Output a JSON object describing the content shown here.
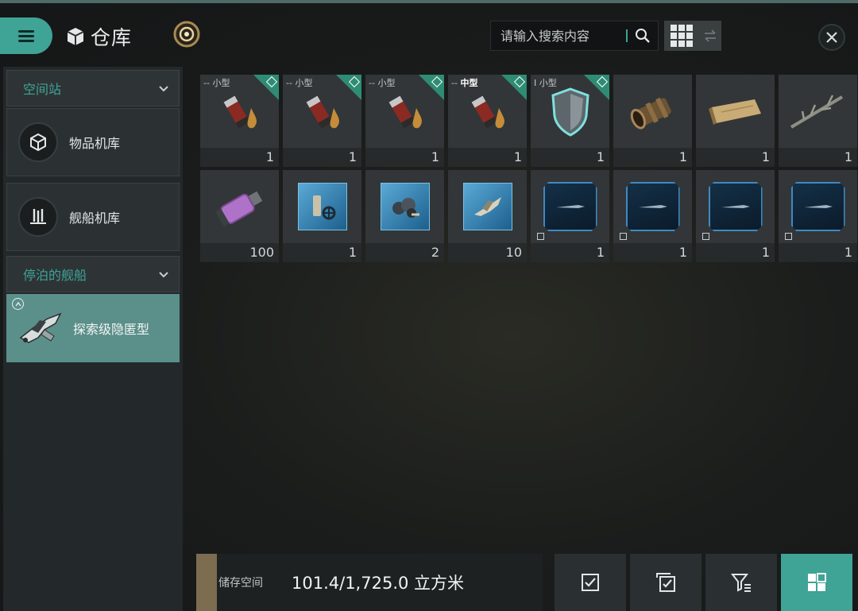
{
  "header": {
    "title": "仓库",
    "search_placeholder": "请输入搜索内容"
  },
  "sidebar": {
    "section_station": "空间站",
    "items": [
      {
        "label": "物品机库"
      },
      {
        "label": "舰船机库"
      }
    ],
    "section_docked": "停泊的舰船",
    "ship": {
      "label": "探索级隐匿型"
    }
  },
  "items": [
    {
      "name": "ammo",
      "size_prefix": "--",
      "size": "小型",
      "qty": "1"
    },
    {
      "name": "ammo",
      "size_prefix": "--",
      "size": "小型",
      "qty": "1"
    },
    {
      "name": "ammo",
      "size_prefix": "--",
      "size": "小型",
      "qty": "1"
    },
    {
      "name": "ammo",
      "size_prefix": "--",
      "size": "中型",
      "qty": "1"
    },
    {
      "name": "shield",
      "size_prefix": "I",
      "size": "小型",
      "qty": "1"
    },
    {
      "name": "tube",
      "qty": "1"
    },
    {
      "name": "scroll",
      "qty": "1"
    },
    {
      "name": "branch",
      "qty": "1"
    },
    {
      "name": "bottle",
      "qty": "100"
    },
    {
      "name": "blue-tile-tool",
      "qty": "1"
    },
    {
      "name": "blue-tile-ore",
      "qty": "2"
    },
    {
      "name": "blue-tile-ship",
      "qty": "10"
    },
    {
      "name": "certificate",
      "qty": "1"
    },
    {
      "name": "certificate",
      "qty": "1"
    },
    {
      "name": "certificate",
      "qty": "1"
    },
    {
      "name": "certificate",
      "qty": "1"
    }
  ],
  "storage": {
    "label": "储存空间",
    "value": "101.4/1,725.0 立方米"
  },
  "colors": {
    "accent": "#3fa396",
    "tag_green": "#2f8c74",
    "selected_ship": "#5b8f8a"
  }
}
